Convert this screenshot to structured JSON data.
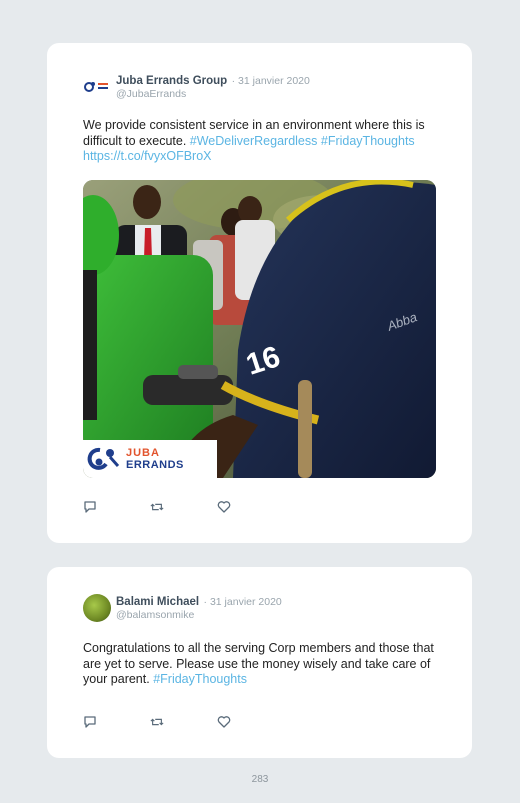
{
  "tweets": [
    {
      "author": "Juba Errands Group",
      "date": "· 31 janvier 2020",
      "handle": "@JubaErrands",
      "text_plain": "We provide consistent service in an environment where this is difficult to execute. ",
      "hashtag1": "#WeDeliverRegardless",
      "hashtag2": "#FridayThoughts",
      "link": "https://t.co/fvyxOFBroX",
      "media": {
        "logo_line1": "JUBA",
        "logo_line2": "ERRANDS",
        "jersey_number": "16"
      },
      "icons": [
        "reply-icon",
        "retweet-icon",
        "like-icon"
      ]
    },
    {
      "author": "Balami Michael",
      "date": "· 31 janvier 2020",
      "handle": "@balamsonmike",
      "text_plain": "Congratulations to all the serving Corp members and those that are yet to serve. Please use the money wisely and take care of your parent. ",
      "hashtag1": "#FridayThoughts",
      "icons": [
        "reply-icon",
        "retweet-icon",
        "like-icon"
      ]
    }
  ],
  "page_number": "283",
  "colors": {
    "background": "#e6eaed",
    "card": "#ffffff",
    "hashtag": "#5bb5e3",
    "name": "#3f4e5c",
    "muted": "#9aa5ad"
  }
}
